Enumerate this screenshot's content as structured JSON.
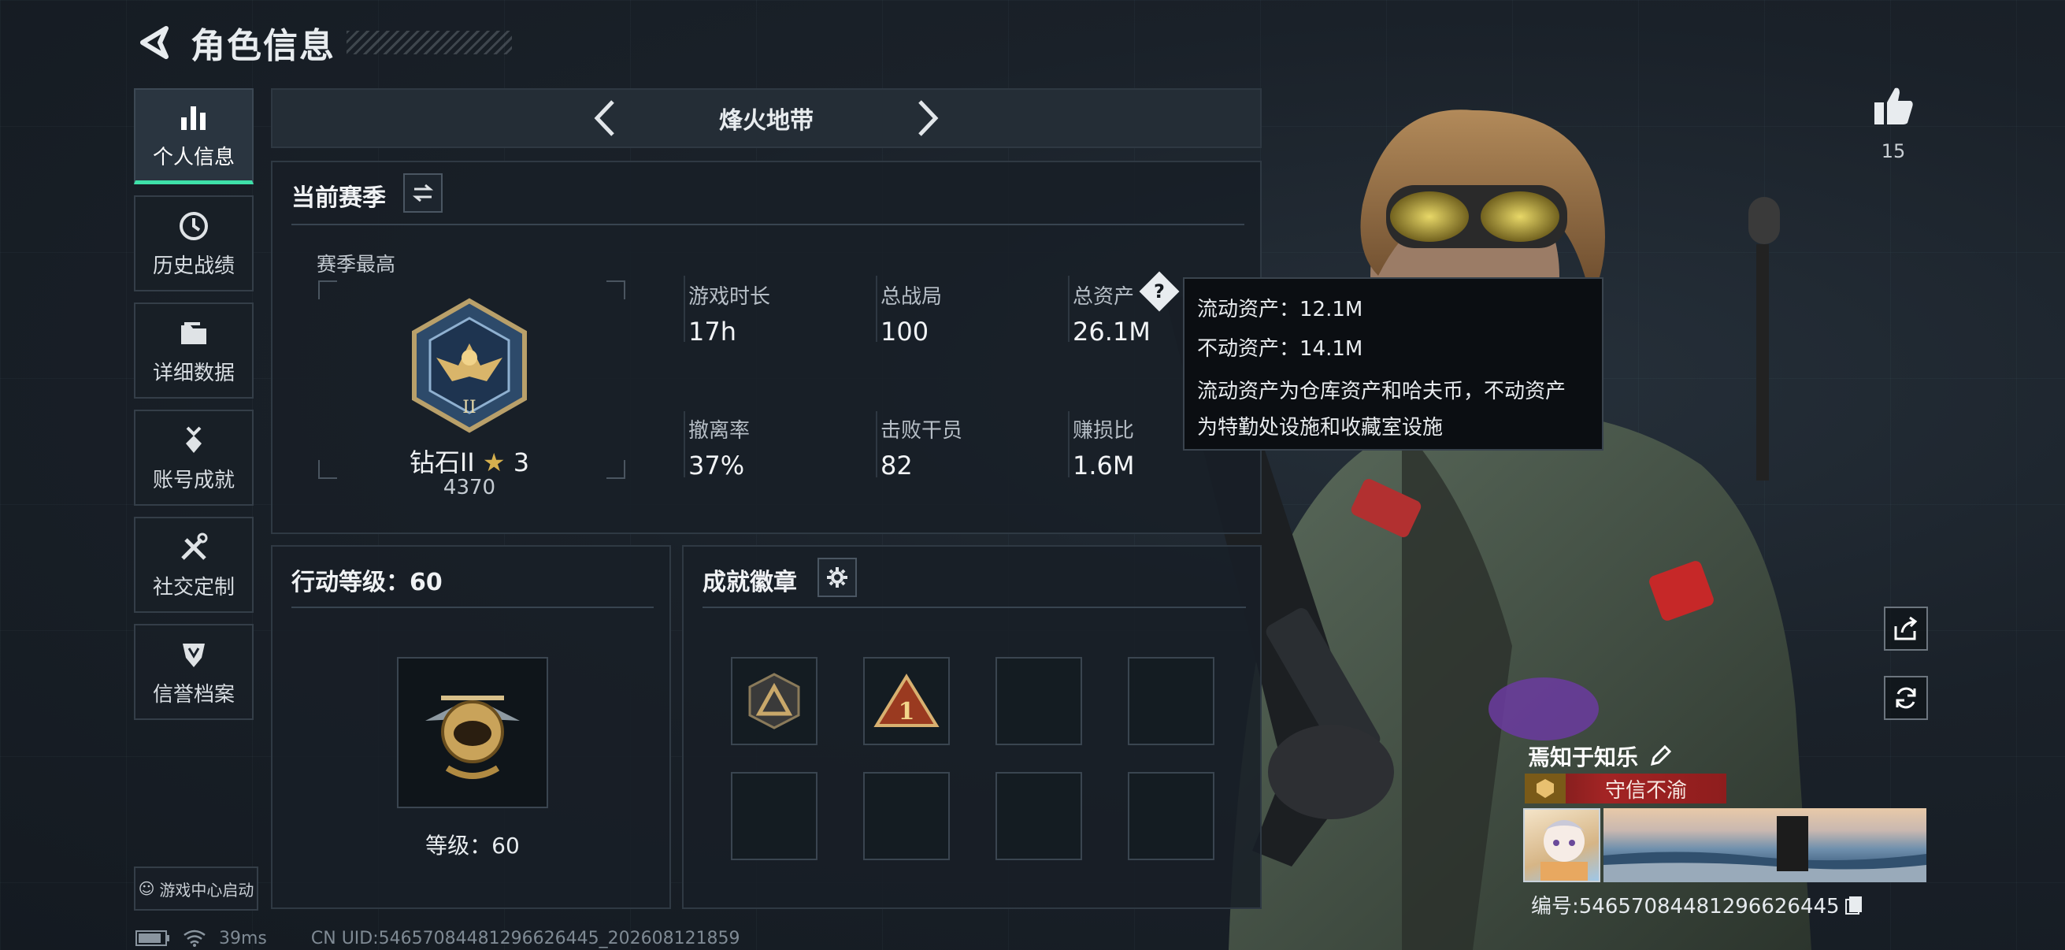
{
  "header": {
    "title": "角色信息"
  },
  "nav": {
    "items": [
      {
        "label": "个人信息",
        "icon": "bar-chart-icon",
        "active": true
      },
      {
        "label": "历史战绩",
        "icon": "history-clock-icon"
      },
      {
        "label": "详细数据",
        "icon": "folder-icon"
      },
      {
        "label": "账号成就",
        "icon": "medal-icon"
      },
      {
        "label": "社交定制",
        "icon": "tools-icon"
      },
      {
        "label": "信誉档案",
        "icon": "shield-crest-icon"
      }
    ],
    "game_center": "游戏中心启动"
  },
  "mode": {
    "name": "烽火地带"
  },
  "season": {
    "title": "当前赛季",
    "best_label": "赛季最高",
    "rank_name": "钻石II",
    "rank_stars": "3",
    "rank_points": "4370",
    "stats": [
      {
        "label": "游戏时长",
        "value": "17h"
      },
      {
        "label": "总战局",
        "value": "100"
      },
      {
        "label": "总资产",
        "value": "26.1M"
      },
      {
        "label": "撤离率",
        "value": "37%"
      },
      {
        "label": "击败干员",
        "value": "82"
      },
      {
        "label": "赚损比",
        "value": "1.6M"
      }
    ]
  },
  "tooltip": {
    "liquid": "流动资产：12.1M",
    "fixed": "不动资产：14.1M",
    "desc_line1": "流动资产为仓库资产和哈夫币，不动资产",
    "desc_line2": "为特勤处设施和收藏室设施"
  },
  "action_level": {
    "title": "行动等级：60",
    "level_label": "等级：60"
  },
  "achievements": {
    "title": "成就徽章",
    "badge_count_filled": 2,
    "slots": 8
  },
  "profile": {
    "likes": "15",
    "player_name": "焉知于知乐",
    "title_tag": "守信不渝",
    "uid_line": "编号:54657084481296626445"
  },
  "footer": {
    "ping": "39ms",
    "uid": "CN UID:54657084481296626445_202608121859"
  },
  "colors": {
    "accent": "#3ee0a8",
    "title_red": "#a32424",
    "panel": "#18202a"
  }
}
